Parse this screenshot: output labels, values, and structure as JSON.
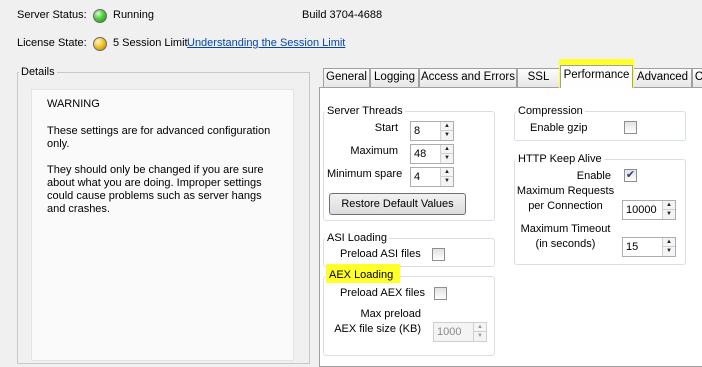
{
  "header": {
    "server_status_label": "Server Status:",
    "server_status_value": "Running",
    "build": "Build 3704-4688",
    "license_label": "License State:",
    "license_value": "5 Session Limit",
    "license_link": "Understanding the Session Limit"
  },
  "details": {
    "title": "Details",
    "warning_title": "WARNING",
    "warning_line1a": "These settings are for advanced configuration",
    "warning_line1b": "only.",
    "warning_line2a": "They should only be changed if you are sure",
    "warning_line2b": "about what you are doing. Improper settings",
    "warning_line2c": "could cause problems such as server hangs",
    "warning_line2d": "and crashes."
  },
  "tabs": [
    {
      "label": "General"
    },
    {
      "label": "Logging"
    },
    {
      "label": "Access and Errors"
    },
    {
      "label": "SSL"
    },
    {
      "label": "Performance"
    },
    {
      "label": "Advanced"
    },
    {
      "label": "C"
    }
  ],
  "active_tab": "Performance",
  "server_threads": {
    "title": "Server Threads",
    "start_label": "Start",
    "start_value": "8",
    "maximum_label": "Maximum",
    "maximum_value": "48",
    "min_spare_label": "Minimum spare",
    "min_spare_value": "4",
    "restore_button": "Restore Default Values"
  },
  "asi_loading": {
    "title": "ASI Loading",
    "preload_label": "Preload ASI files",
    "preload_checked": false
  },
  "aex_loading": {
    "title": "AEX Loading",
    "preload_label": "Preload AEX files",
    "preload_checked": false,
    "max_preload_label1": "Max preload",
    "max_preload_label2": "AEX file size (KB)",
    "max_preload_value": "1000"
  },
  "compression": {
    "title": "Compression",
    "enable_gzip_label": "Enable gzip",
    "enable_gzip_checked": false
  },
  "keep_alive": {
    "title": "HTTP Keep Alive",
    "enable_label": "Enable",
    "enable_checked": true,
    "max_requests_label1": "Maximum Requests",
    "max_requests_label2": "per Connection",
    "max_requests_value": "10000",
    "max_timeout_label1": "Maximum Timeout",
    "max_timeout_label2": "(in seconds)",
    "max_timeout_value": "15"
  },
  "colors": {
    "highlight": "#ffff2a",
    "link": "#0645ad",
    "status_running": "#3fbf2f",
    "status_license": "#f2c530"
  }
}
